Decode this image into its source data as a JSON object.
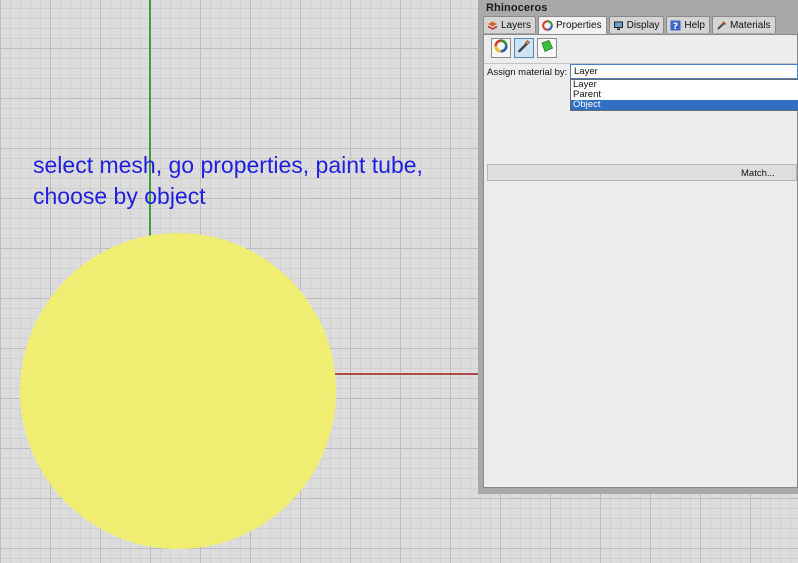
{
  "annotation": {
    "line1": "select mesh, go properties, paint tube,",
    "line2": "choose by object"
  },
  "panel": {
    "title": "Rhinoceros",
    "tabs": [
      {
        "label": "Layers",
        "icon": "layers-icon"
      },
      {
        "label": "Properties",
        "icon": "properties-icon"
      },
      {
        "label": "Display",
        "icon": "display-icon"
      },
      {
        "label": "Help",
        "icon": "help-icon"
      },
      {
        "label": "Materials",
        "icon": "materials-icon"
      }
    ],
    "toolbar": [
      "color-wheel-icon",
      "paint-tube-icon",
      "texture-mapping-icon"
    ],
    "assign_label": "Assign material by:",
    "select_value": "Layer",
    "options": [
      "Layer",
      "Parent",
      "Object"
    ],
    "selected_option": "Object",
    "match_label": "Match..."
  },
  "colors": {
    "mesh": "#f0ee72",
    "annotation_text": "#1f1fe0",
    "y_axis": "#3d9a3d",
    "x_axis": "#b04a4a",
    "selection": "#2f6fc4"
  }
}
